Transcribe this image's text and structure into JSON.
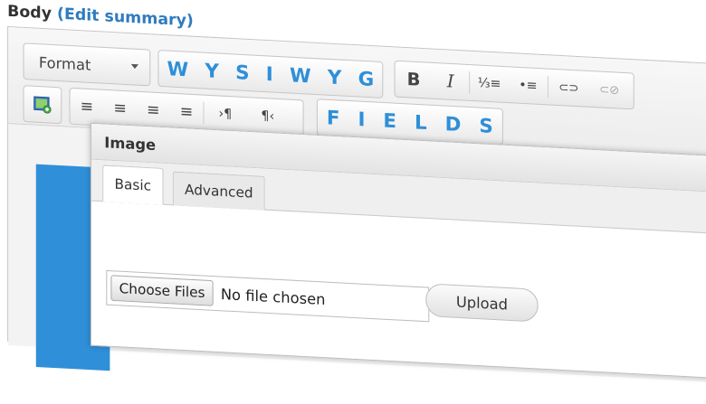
{
  "field": {
    "label": "Body",
    "open_paren": "(",
    "link": "Edit summary",
    "close_paren": ")"
  },
  "toolbar": {
    "format_label": "Format",
    "wysiwyg_letters": [
      "W",
      "Y",
      "S",
      "I",
      "W",
      "Y",
      "G"
    ],
    "bold_glyph": "B",
    "italic_glyph": "I",
    "numbered_list_glyph": "⅓≡",
    "bulleted_list_glyph": "•≡",
    "link_glyph": "⊂⊃",
    "unlink_glyph": "⊂⊘",
    "align_left_glyph": "≡",
    "align_center_glyph": "≡",
    "align_right_glyph": "≡",
    "align_justify_glyph": "≡",
    "ltr_glyph": "›¶",
    "rtl_glyph": "¶‹",
    "fields_letters": [
      "F",
      "I",
      "E",
      "L",
      "D",
      "S"
    ],
    "accent_color": "#2f8fd8"
  },
  "dialog": {
    "title": "Image",
    "tabs": [
      {
        "label": "Basic",
        "active": true
      },
      {
        "label": "Advanced",
        "active": false
      }
    ],
    "choose_button": "Choose Files",
    "file_status": "No file chosen",
    "upload_button": "Upload"
  }
}
